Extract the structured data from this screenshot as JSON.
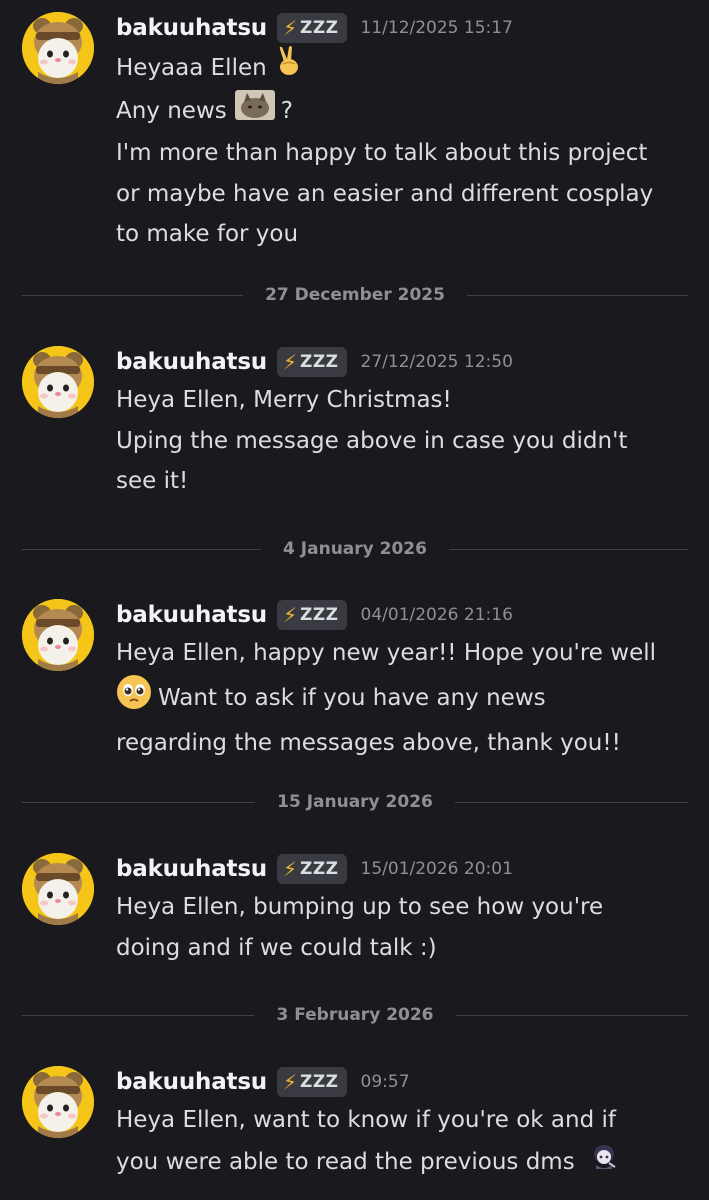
{
  "messages": [
    {
      "author": "bakuuhatsu",
      "tag": "ZZZ",
      "tag_icon": "lightning-bolt-icon",
      "timestamp": "11/12/2025 15:17",
      "lines": {
        "l1": "Heyaaa Ellen",
        "l2a": "Any news",
        "l2b": "?",
        "l3": "I'm more than happy to talk about this project",
        "l4": "or maybe have an easier and different cosplay",
        "l5": "to make for you"
      },
      "emojis": [
        "victory-hand-emoji",
        "cat-sticker-emoji"
      ]
    },
    {
      "author": "bakuuhatsu",
      "tag": "ZZZ",
      "timestamp": "27/12/2025 12:50",
      "lines": {
        "l1": "Heya Ellen, Merry Christmas!",
        "l2": "Uping the message above in case you didn't",
        "l3": "see it!"
      }
    },
    {
      "author": "bakuuhatsu",
      "tag": "ZZZ",
      "timestamp": "04/01/2026 21:16",
      "lines": {
        "l1": "Heya Ellen, happy new year!! Hope you're well",
        "l2": "Want to ask if you have any news",
        "l3": "regarding the messages above, thank you!!"
      },
      "emojis": [
        "pleading-face-emoji"
      ]
    },
    {
      "author": "bakuuhatsu",
      "tag": "ZZZ",
      "timestamp": "15/01/2026 20:01",
      "lines": {
        "l1": "Heya Ellen, bumping up to see how you're",
        "l2": "doing and if we could talk :)"
      }
    },
    {
      "author": "bakuuhatsu",
      "tag": "ZZZ",
      "timestamp": "09:57",
      "lines": {
        "l1": "Heya Ellen, want to know if you're ok and if",
        "l2": "you were able to read the previous dms"
      },
      "emojis": [
        "character-sticker-emoji"
      ]
    }
  ],
  "dividers": [
    "27 December 2025",
    "4 January 2026",
    "15 January 2026",
    "3 February 2026"
  ],
  "colors": {
    "background": "#1a1a1e",
    "text": "#dbdee1",
    "username": "#f2f3f5",
    "muted": "#8e9097",
    "tag_bg": "#3a3b42",
    "bolt": "#f0b232",
    "avatar_bg": "#f5c518"
  }
}
